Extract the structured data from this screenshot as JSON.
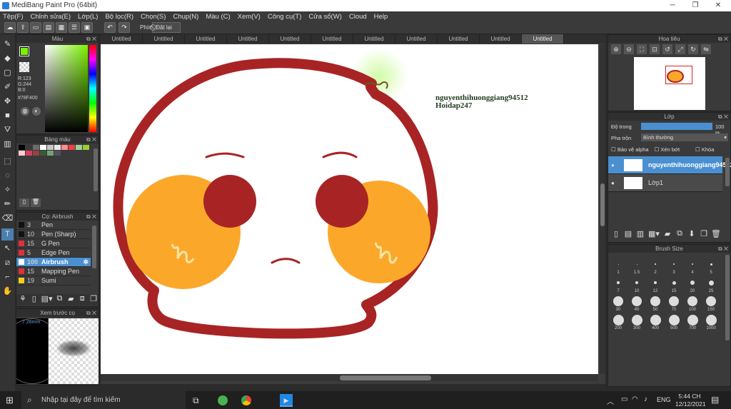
{
  "window": {
    "title": "MediBang Paint Pro (64bit)"
  },
  "menu": [
    "Tệp(F)",
    "Chỉnh sửa(E)",
    "Lớp(L)",
    "Bộ lọc(R)",
    "Chọn(S)",
    "Chụp(N)",
    "Màu (C)",
    "Xem(V)",
    "Công cụ(T)",
    "Cửa sổ(W)",
    "Cloud",
    "Help"
  ],
  "toolbar": {
    "shortcut_label": "Phím",
    "reset_label": "Đặt lại"
  },
  "tabs": [
    "Untitled",
    "Untitled",
    "Untitled",
    "Untitled",
    "Untitled",
    "Untitled",
    "Untitled",
    "Untitled",
    "Untitled",
    "Untitled",
    "Untitled"
  ],
  "color_panel": {
    "title": "Màu",
    "r": "R:123",
    "g": "G:244",
    "b": "B:0",
    "hex": "#78F400",
    "current_color": "#7bf400"
  },
  "palette_panel": {
    "title": "Bảng màu"
  },
  "brush_panel": {
    "title": "Cọ: Airbrush",
    "brushes": [
      {
        "size": "3",
        "name": "Pen",
        "color": "#111111",
        "selected": false
      },
      {
        "size": "10",
        "name": "Pen (Sharp)",
        "color": "#111111",
        "selected": false
      },
      {
        "size": "15",
        "name": "G Pen",
        "color": "#e0303a",
        "selected": false
      },
      {
        "size": "5",
        "name": "Edge Pen",
        "color": "#e0303a",
        "selected": false
      },
      {
        "size": "100",
        "name": "Airbrush",
        "color": "#ffffff",
        "selected": true
      },
      {
        "size": "15",
        "name": "Mapping Pen",
        "color": "#e0303a",
        "selected": false
      },
      {
        "size": "19",
        "name": "Sumi",
        "color": "#f0d020",
        "selected": false
      }
    ]
  },
  "preview_panel": {
    "title": "Xem trước cọ",
    "size_text": "7.26mm"
  },
  "navigator": {
    "title": "Hoa tiêu"
  },
  "layer_panel": {
    "title": "Lớp",
    "opacity_label": "Độ trong",
    "opacity_value": "100 %",
    "opacity_level": 1.0,
    "blend_label": "Pha trộn",
    "blend_value": "Bình thường",
    "protect_alpha": "Bảo vệ alpha",
    "clipping": "Xén bớt",
    "lock": "Khóa",
    "layers": [
      {
        "name": "nguyenthihuonggiang94512",
        "selected": true
      },
      {
        "name": "Lớp1",
        "selected": false
      }
    ]
  },
  "brush_size_panel": {
    "title": "Brush Size",
    "sizes": [
      "1",
      "1.5",
      "2",
      "3",
      "4",
      "5",
      "7",
      "10",
      "12",
      "15",
      "20",
      "25",
      "30",
      "40",
      "50",
      "70",
      "100",
      "150",
      "200",
      "300",
      "400",
      "500",
      "700",
      "1000"
    ]
  },
  "canvas_text": {
    "line1": "nguyenthihuonggiang94512",
    "line2": "Hoidap247"
  },
  "taskbar": {
    "search_placeholder": "Nhập tại đây để tìm kiếm",
    "lang": "ENG",
    "time": "5:44 CH",
    "date": "12/12/2021"
  }
}
